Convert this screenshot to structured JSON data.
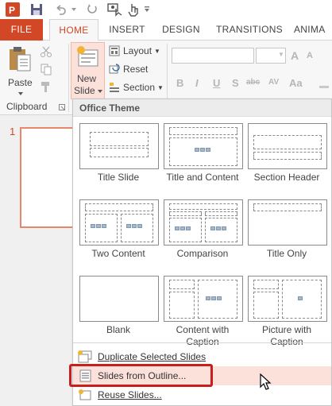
{
  "quick_access": {
    "icons": [
      "powerpoint-app-icon",
      "save-icon",
      "undo-icon",
      "repeat-icon",
      "touch-mode-icon"
    ]
  },
  "tabs": [
    {
      "label": "FILE"
    },
    {
      "label": "HOME"
    },
    {
      "label": "INSERT"
    },
    {
      "label": "DESIGN"
    },
    {
      "label": "TRANSITIONS"
    },
    {
      "label": "ANIMA"
    }
  ],
  "ribbon": {
    "clipboard": {
      "paste_label": "Paste",
      "group_label": "Clipboard"
    },
    "slides": {
      "new_slide_line1": "New",
      "new_slide_line2": "Slide",
      "layout_label": "Layout",
      "reset_label": "Reset",
      "section_label": "Section"
    },
    "font": {
      "bold": "B",
      "italic": "I",
      "underline": "U",
      "strike": "S",
      "shadow": "abc",
      "spacing": "AV",
      "case": "Aa",
      "grow": "A",
      "shrink": "A"
    }
  },
  "thumbnail": {
    "number": "1"
  },
  "dropdown": {
    "header": "Office Theme",
    "layouts": [
      {
        "label": "Title Slide"
      },
      {
        "label": "Title and Content"
      },
      {
        "label": "Section Header"
      },
      {
        "label": "Two Content"
      },
      {
        "label": "Comparison"
      },
      {
        "label": "Title Only"
      },
      {
        "label": "Blank"
      },
      {
        "label": "Content with Caption"
      },
      {
        "label": "Picture with Caption"
      }
    ],
    "commands": [
      {
        "label": "Duplicate Selected Slides"
      },
      {
        "label": "Slides from Outline..."
      },
      {
        "label": "Reuse Slides..."
      }
    ]
  },
  "colors": {
    "accent": "#d24726",
    "highlight_border": "#c81e1e",
    "hover": "#fbe1da"
  }
}
